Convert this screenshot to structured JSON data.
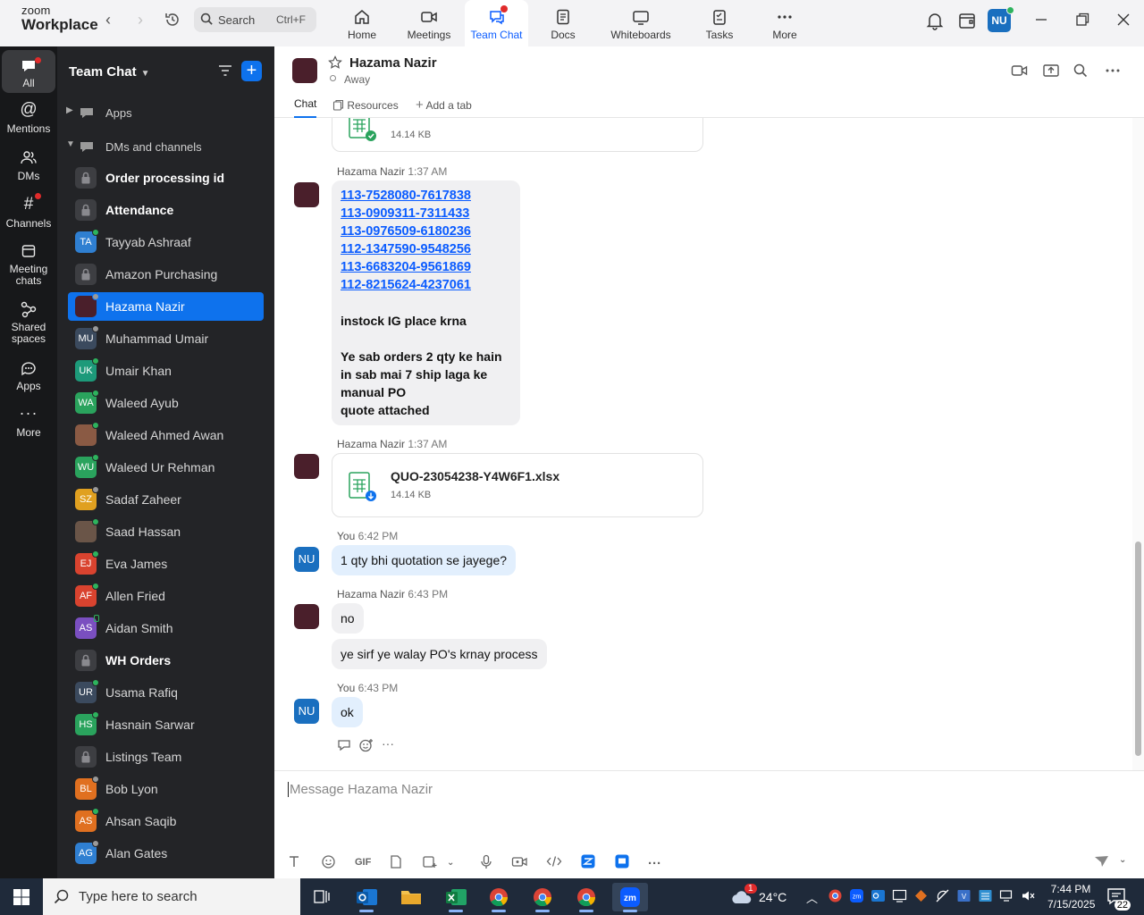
{
  "app": {
    "logo_top": "zoom",
    "logo_bottom": "Workplace"
  },
  "search": {
    "label": "Search",
    "shortcut": "Ctrl+F"
  },
  "nav_tabs": [
    {
      "label": "Home",
      "icon": "home-icon"
    },
    {
      "label": "Meetings",
      "icon": "camera-icon"
    },
    {
      "label": "Team Chat",
      "icon": "chat-icon",
      "active": true
    },
    {
      "label": "Docs",
      "icon": "doc-icon"
    },
    {
      "label": "Whiteboards",
      "icon": "whiteboard-icon"
    },
    {
      "label": "Tasks",
      "icon": "tasks-icon"
    },
    {
      "label": "More",
      "icon": "more-icon"
    }
  ],
  "user": {
    "initials": "NU"
  },
  "rail": [
    {
      "label": "All"
    },
    {
      "label": "Mentions"
    },
    {
      "label": "DMs"
    },
    {
      "label": "Channels"
    },
    {
      "label": "Meeting chats"
    },
    {
      "label": "Shared spaces"
    },
    {
      "label": "Apps"
    },
    {
      "label": "More"
    }
  ],
  "sidebar": {
    "title": "Team Chat",
    "sections": [
      {
        "label": "Apps"
      },
      {
        "label": "DMs and channels"
      }
    ],
    "items": [
      {
        "name": "Order processing id",
        "initials": "",
        "kind": "lock",
        "bold": true
      },
      {
        "name": "Attendance",
        "initials": "",
        "kind": "lock",
        "bold": true
      },
      {
        "name": "Tayyab Ashraaf",
        "initials": "TA",
        "color": "#2f7fd1",
        "status": "online"
      },
      {
        "name": "Amazon Purchasing",
        "initials": "",
        "kind": "lock"
      },
      {
        "name": "Hazama Nazir",
        "initials": "",
        "color": "#4a1f2b",
        "status": "away",
        "active": true
      },
      {
        "name": "Muhammad Umair",
        "initials": "MU",
        "color": "#3b4a5e",
        "status": "away"
      },
      {
        "name": "Umair Khan",
        "initials": "UK",
        "color": "#1d9a7a",
        "status": "online"
      },
      {
        "name": "Waleed Ayub",
        "initials": "WA",
        "color": "#2aa35d",
        "status": "online"
      },
      {
        "name": "Waleed Ahmed Awan",
        "initials": "",
        "color": "#8a5a44",
        "status": "online"
      },
      {
        "name": "Waleed Ur Rehman",
        "initials": "WU",
        "color": "#2aa35d",
        "status": "online"
      },
      {
        "name": "Sadaf Zaheer",
        "initials": "SZ",
        "color": "#e0a020",
        "status": "away"
      },
      {
        "name": "Saad Hassan",
        "initials": "",
        "color": "#6a5548",
        "status": "online"
      },
      {
        "name": "Eva James",
        "initials": "EJ",
        "color": "#d9432f",
        "status": "online"
      },
      {
        "name": "Allen Fried",
        "initials": "AF",
        "color": "#d9432f",
        "status": "online"
      },
      {
        "name": "Aidan Smith",
        "initials": "AS",
        "color": "#7a4fc0",
        "status": "mobile"
      },
      {
        "name": "WH Orders",
        "initials": "",
        "kind": "lock",
        "bold": true
      },
      {
        "name": "Usama Rafiq",
        "initials": "UR",
        "color": "#3b4a5e",
        "status": "online"
      },
      {
        "name": "Hasnain Sarwar",
        "initials": "HS",
        "color": "#2aa35d",
        "status": "online"
      },
      {
        "name": "Listings Team",
        "initials": "",
        "kind": "lock"
      },
      {
        "name": "Bob Lyon",
        "initials": "BL",
        "color": "#e07020",
        "status": "away"
      },
      {
        "name": "Ahsan Saqib",
        "initials": "AS",
        "color": "#e07020",
        "status": "online"
      },
      {
        "name": "Alan Gates",
        "initials": "AG",
        "color": "#2f7fd1",
        "status": "away"
      }
    ]
  },
  "chat_header": {
    "name": "Hazama Nazir",
    "status": "Away"
  },
  "chat_tabs": [
    {
      "label": "Chat",
      "active": true
    },
    {
      "label": "Resources"
    },
    {
      "label": "Add a tab"
    }
  ],
  "messages": {
    "top_file_size": "14.14 KB",
    "m1": {
      "sender": "Hazama Nazir",
      "time": "1:37 AM",
      "links": [
        "113-7528080-7617838",
        "113-0909311-7311433",
        "113-0976509-6180236",
        "112-1347590-9548256",
        "113-6683204-9561869",
        "112-8215624-4237061"
      ],
      "line1": "instock IG place krna",
      "line2": "Ye sab orders 2 qty ke hain",
      "line3": "in sab mai 7 ship laga ke",
      "line4": "manual PO",
      "line5": "quote attached"
    },
    "m2": {
      "sender": "Hazama Nazir",
      "time": "1:37 AM",
      "file_name": "QUO-23054238-Y4W6F1.xlsx",
      "file_size": "14.14 KB"
    },
    "m3": {
      "sender": "You",
      "time": "6:42 PM",
      "text": "1 qty bhi quotation se jayege?"
    },
    "m4": {
      "sender": "Hazama Nazir",
      "time": "6:43 PM",
      "text1": "no",
      "text2": "ye sirf ye walay PO's krnay process"
    },
    "m5": {
      "sender": "You",
      "time": "6:43 PM",
      "text": "ok"
    }
  },
  "composer": {
    "placeholder": "Message Hazama Nazir",
    "gif_label": "GIF"
  },
  "taskbar": {
    "search_placeholder": "Type here to search",
    "weather": "24°C",
    "weather_badge": "1",
    "time": "7:44 PM",
    "date": "7/15/2025",
    "notifications": "22"
  }
}
